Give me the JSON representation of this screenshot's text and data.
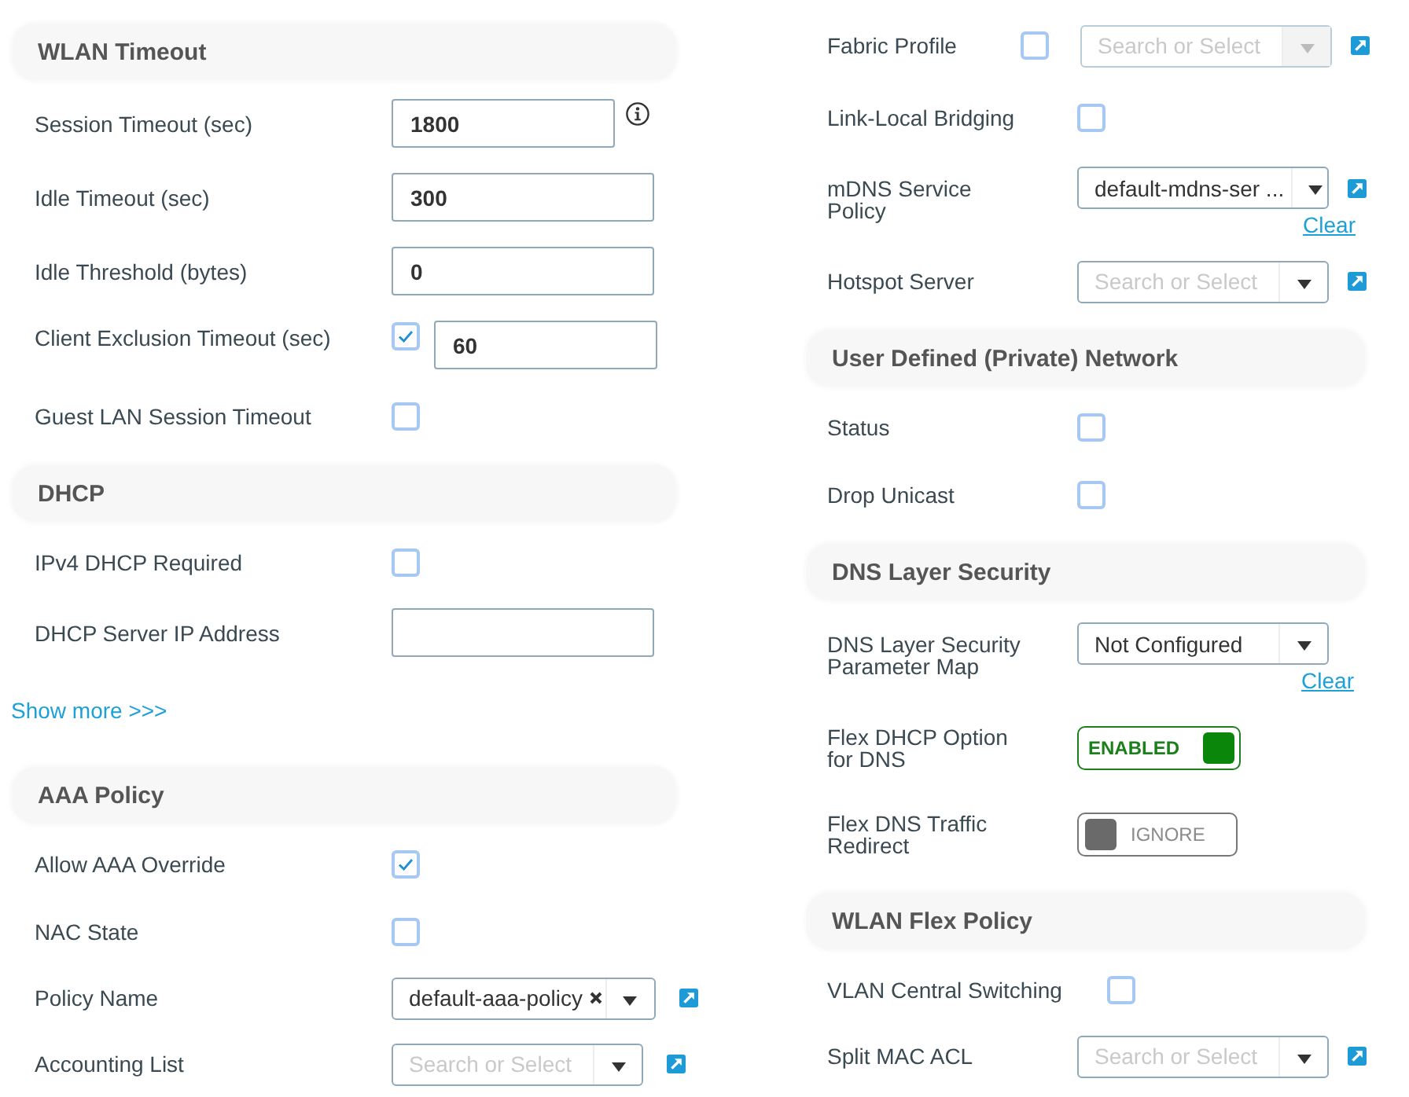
{
  "columns": [
    {
      "sections": [
        {
          "title": "WLAN Timeout",
          "rows": [
            {
              "kind": "input",
              "label": "Session Timeout (sec)",
              "value": "1800",
              "info": true
            },
            {
              "kind": "input",
              "label": "Idle Timeout (sec)",
              "value": "300"
            },
            {
              "kind": "input",
              "label": "Idle Threshold (bytes)",
              "value": "0"
            },
            {
              "kind": "checkbox-input",
              "label": "Client Exclusion Timeout (sec)",
              "checked": true,
              "value": "60"
            },
            {
              "kind": "checkbox",
              "label": "Guest LAN Session Timeout",
              "checked": false
            }
          ]
        },
        {
          "title": "DHCP",
          "rows": [
            {
              "kind": "checkbox",
              "label": "IPv4 DHCP Required",
              "checked": false
            },
            {
              "kind": "input",
              "label": "DHCP Server IP Address"
            }
          ],
          "link": "Show more >>>"
        },
        {
          "title": "AAA Policy",
          "rows": [
            {
              "kind": "checkbox",
              "label": "Allow AAA Override",
              "checked": true
            },
            {
              "kind": "checkbox",
              "label": "NAC State",
              "checked": false
            },
            {
              "kind": "select",
              "label": "Policy Name",
              "value": "default-aaa-policy",
              "clear_mark": true,
              "external_link": true
            },
            {
              "kind": "select",
              "label": "Accounting List",
              "placeholder": "Search or Select",
              "external_link": true
            }
          ]
        }
      ]
    },
    {
      "sections": [
        {
          "rows": [
            {
              "kind": "checkbox-select",
              "label": "Fabric Profile",
              "checked": false,
              "placeholder": "Search or Select",
              "disabled": true,
              "external_link": true
            },
            {
              "kind": "checkbox",
              "label": "Link-Local Bridging",
              "checked": false
            },
            {
              "kind": "select",
              "label": "mDNS Service Policy",
              "value": "default-mdns-ser ...",
              "external_link": true,
              "clear": "Clear"
            },
            {
              "kind": "select",
              "label": "Hotspot Server",
              "placeholder": "Search or Select",
              "external_link": true
            }
          ]
        },
        {
          "title": "User Defined (Private) Network",
          "rows": [
            {
              "kind": "checkbox",
              "label": "Status",
              "checked": false
            },
            {
              "kind": "checkbox",
              "label": "Drop Unicast",
              "checked": false
            }
          ]
        },
        {
          "title": "DNS Layer Security",
          "rows": [
            {
              "kind": "select",
              "label": "DNS Layer Security Parameter Map",
              "value": "Not Configured",
              "clear": "Clear"
            },
            {
              "kind": "toggle",
              "label": "Flex DHCP Option for DNS",
              "on": true,
              "text": "ENABLED"
            },
            {
              "kind": "toggle",
              "label": "Flex DNS Traffic Redirect",
              "on": false,
              "text": "IGNORE"
            }
          ]
        },
        {
          "title": "WLAN Flex Policy",
          "rows": [
            {
              "kind": "checkbox",
              "label": "VLAN Central Switching",
              "checked": false
            },
            {
              "kind": "select",
              "label": "Split MAC ACL",
              "placeholder": "Search or Select",
              "external_link": true
            }
          ]
        }
      ]
    }
  ]
}
